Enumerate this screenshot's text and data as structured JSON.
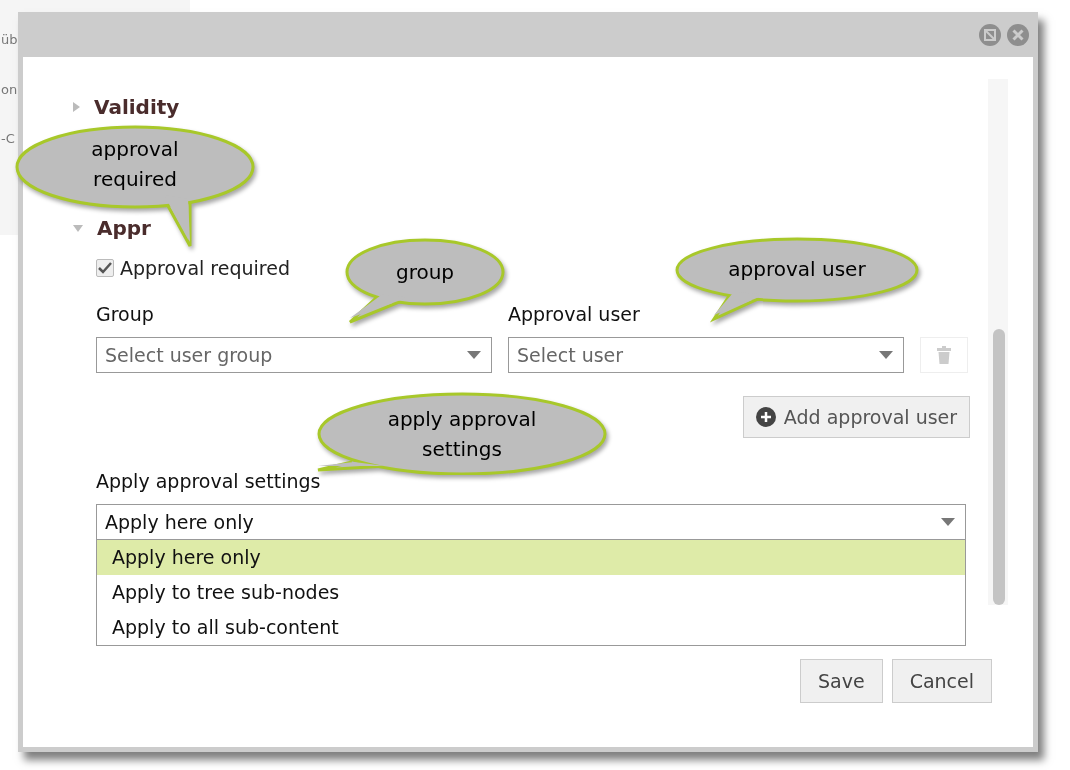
{
  "background": {
    "fragments": [
      "üb",
      "on",
      "-C"
    ]
  },
  "dialog": {
    "sections": [
      {
        "title": "Validity",
        "expanded": false
      },
      {
        "title": "Appr",
        "expanded": true
      }
    ],
    "approval_required": {
      "label": "Approval required",
      "checked": true
    },
    "group": {
      "label": "Group",
      "placeholder": "Select user group"
    },
    "approval_user": {
      "label": "Approval user",
      "placeholder": "Select user"
    },
    "add_button": "Add approval user",
    "apply": {
      "label": "Apply approval settings",
      "value": "Apply here only",
      "options": [
        {
          "label": "Apply here only",
          "selected": true
        },
        {
          "label": "Apply to tree sub-nodes",
          "selected": false
        },
        {
          "label": "Apply to all sub-content",
          "selected": false
        }
      ]
    },
    "buttons": [
      "Save",
      "Cancel"
    ]
  },
  "callouts": [
    {
      "text": "approval required"
    },
    {
      "text": "group"
    },
    {
      "text": "approval user"
    },
    {
      "text": "apply approval settings"
    }
  ]
}
